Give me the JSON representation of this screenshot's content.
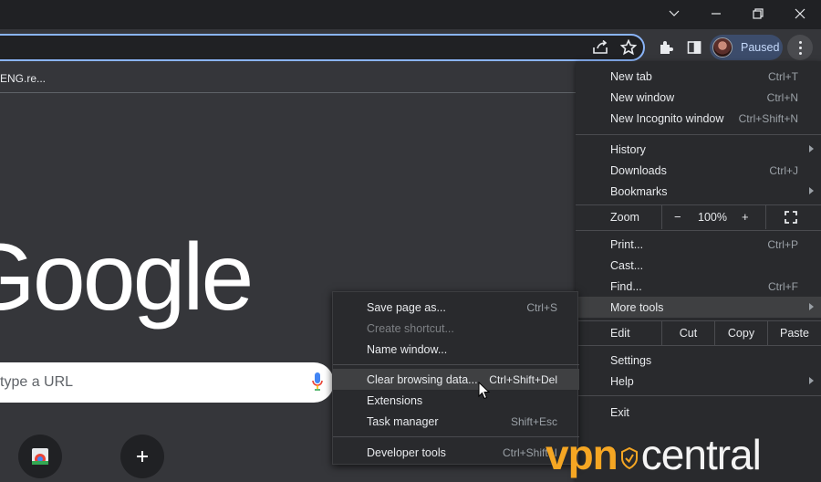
{
  "browser": {
    "bookmark_item": "ENG.re...",
    "profile_label": "Paused"
  },
  "ntp": {
    "logo_text": "Google",
    "search_placeholder": "type a URL"
  },
  "menu": {
    "new_tab": {
      "label": "New tab",
      "shortcut": "Ctrl+T"
    },
    "new_window": {
      "label": "New window",
      "shortcut": "Ctrl+N"
    },
    "new_incognito": {
      "label": "New Incognito window",
      "shortcut": "Ctrl+Shift+N"
    },
    "history": {
      "label": "History"
    },
    "downloads": {
      "label": "Downloads",
      "shortcut": "Ctrl+J"
    },
    "bookmarks": {
      "label": "Bookmarks"
    },
    "zoom": {
      "label": "Zoom",
      "minus": "−",
      "value": "100%",
      "plus": "+"
    },
    "print": {
      "label": "Print...",
      "shortcut": "Ctrl+P"
    },
    "cast": {
      "label": "Cast..."
    },
    "find": {
      "label": "Find...",
      "shortcut": "Ctrl+F"
    },
    "more_tools": {
      "label": "More tools"
    },
    "edit": {
      "label": "Edit",
      "cut": "Cut",
      "copy": "Copy",
      "paste": "Paste"
    },
    "settings": {
      "label": "Settings"
    },
    "help": {
      "label": "Help"
    },
    "exit": {
      "label": "Exit"
    }
  },
  "submenu": {
    "save_page": {
      "label": "Save page as...",
      "shortcut": "Ctrl+S"
    },
    "create_shortcut": {
      "label": "Create shortcut..."
    },
    "name_window": {
      "label": "Name window..."
    },
    "clear_data": {
      "label": "Clear browsing data...",
      "shortcut": "Ctrl+Shift+Del"
    },
    "extensions": {
      "label": "Extensions"
    },
    "task_manager": {
      "label": "Task manager",
      "shortcut": "Shift+Esc"
    },
    "dev_tools": {
      "label": "Developer tools",
      "shortcut": "Ctrl+Shift+I"
    }
  },
  "watermark": {
    "part1": "vpn",
    "part2": "central"
  },
  "colors": {
    "accent": "#8ab4f8",
    "menu_bg": "#292a2d",
    "highlight": "#3f4042",
    "watermark": "#f5a623"
  }
}
